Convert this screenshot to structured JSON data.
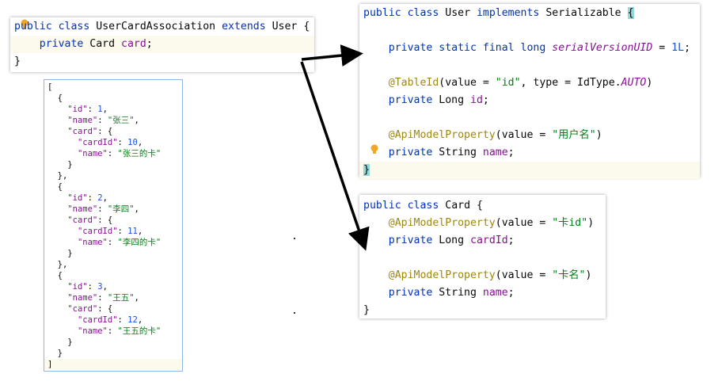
{
  "association": {
    "lines": [
      [
        "public",
        "class",
        "UserCardAssociation",
        "extends",
        "User",
        "{"
      ],
      [
        "private",
        "Card",
        "card",
        ";"
      ],
      [
        "}"
      ]
    ]
  },
  "user": {
    "l1": [
      "public",
      "class",
      "User",
      "implements",
      "Serializable",
      "{"
    ],
    "l2": [
      "private",
      "static",
      "final",
      "long",
      "serialVersionUID",
      "=",
      "1L",
      ";"
    ],
    "l3": [
      "@TableId",
      "(value =",
      "\"id\"",
      ", type = IdType.",
      "AUTO",
      ")"
    ],
    "l4": [
      "private",
      "Long",
      "id",
      ";"
    ],
    "l5": [
      "@ApiModelProperty",
      "(value =",
      "\"用户名\"",
      ")"
    ],
    "l6": [
      "private",
      "String",
      "name",
      ";"
    ],
    "l7": "}"
  },
  "card": {
    "l1": [
      "public",
      "class",
      "Card",
      "{"
    ],
    "l2": [
      "@ApiModelProperty",
      "(value =",
      "\"卡id\"",
      ")"
    ],
    "l3": [
      "private",
      "Long",
      "cardId",
      ";"
    ],
    "l4": [
      "@ApiModelProperty",
      "(value =",
      "\"卡名\"",
      ")"
    ],
    "l5": [
      "private",
      "String",
      "name",
      ";"
    ],
    "l6": "}"
  },
  "json": {
    "open": "[",
    "close": "]",
    "items": [
      {
        "id": "1",
        "name": "\"张三\"",
        "cardId": "10",
        "cardName": "\"张三的卡\""
      },
      {
        "id": "2",
        "name": "\"李四\"",
        "cardId": "11",
        "cardName": "\"李四的卡\""
      },
      {
        "id": "3",
        "name": "\"王五\"",
        "cardId": "12",
        "cardName": "\"王五的卡\""
      }
    ],
    "keys": {
      "id": "\"id\"",
      "name": "\"name\"",
      "card": "\"card\"",
      "cardId": "\"cardId\""
    }
  }
}
